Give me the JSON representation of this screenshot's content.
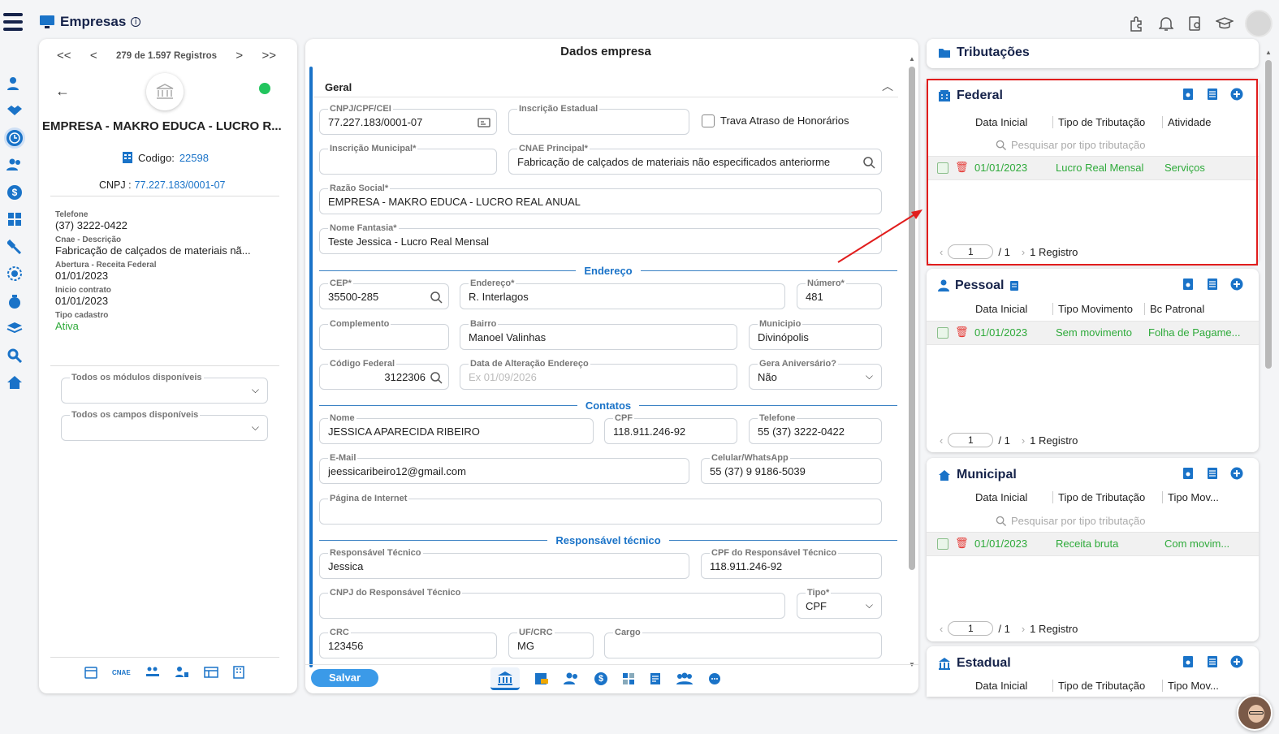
{
  "app": {
    "title": "Empresas"
  },
  "nav": {
    "first": "<<",
    "prev": "<",
    "record_count": "279 de 1.597 Registros",
    "next": ">",
    "last": ">>"
  },
  "company": {
    "name": "EMPRESA - MAKRO EDUCA - LUCRO R...",
    "code_label": "Codigo:",
    "code": "22598",
    "cnpj_label": "CNPJ :",
    "cnpj": "77.227.183/0001-07",
    "status_color": "#22c55e"
  },
  "info": [
    {
      "label": "Telefone",
      "value": "(37) 3222-0422"
    },
    {
      "label": "Cnae - Descrição",
      "value": "Fabricação de calçados de materiais nã..."
    },
    {
      "label": "Abertura - Receita Federal",
      "value": "01/01/2023"
    },
    {
      "label": "Inicio contrato",
      "value": "01/01/2023"
    },
    {
      "label": "Tipo cadastro",
      "value": "Ativa"
    }
  ],
  "filters": {
    "modules": "Todos os módulos disponíveis",
    "fields": "Todos os campos disponíveis"
  },
  "left_bottom": {
    "cnae": "CNAE"
  },
  "form": {
    "header": "Dados empresa",
    "section_general": "Geral",
    "cnpj": {
      "label": "CNPJ/CPF/CEI",
      "value": "77.227.183/0001-07"
    },
    "ie": {
      "label": "Inscrição Estadual",
      "value": ""
    },
    "trava": "Trava Atraso de Honorários",
    "im": {
      "label": "Inscrição Municipal*",
      "value": ""
    },
    "cnae": {
      "label": "CNAE Principal*",
      "value": "Fabricação de calçados de materiais não especificados anteriorme"
    },
    "razao": {
      "label": "Razão Social*",
      "value": "EMPRESA - MAKRO EDUCA - LUCRO REAL ANUAL"
    },
    "fantasia": {
      "label": "Nome Fantasia*",
      "value": "Teste Jessica - Lucro Real Mensal"
    },
    "sec_endereco": "Endereço",
    "cep": {
      "label": "CEP*",
      "value": "35500-285"
    },
    "endereco": {
      "label": "Endereço*",
      "value": "R. Interlagos"
    },
    "numero": {
      "label": "Número*",
      "value": "481"
    },
    "complemento": {
      "label": "Complemento",
      "value": ""
    },
    "bairro": {
      "label": "Bairro",
      "value": "Manoel Valinhas"
    },
    "municipio": {
      "label": "Municipio",
      "value": "Divinópolis"
    },
    "codfed": {
      "label": "Código Federal",
      "value": "3122306"
    },
    "dataalt": {
      "label": "Data de Alteração Endereço",
      "placeholder": "Ex 01/09/2026"
    },
    "aniv": {
      "label": "Gera Aniversário?",
      "value": "Não"
    },
    "sec_contatos": "Contatos",
    "nome": {
      "label": "Nome",
      "value": "JESSICA APARECIDA RIBEIRO"
    },
    "cpf": {
      "label": "CPF",
      "value": "118.911.246-92"
    },
    "telefone": {
      "label": "Telefone",
      "value": "55 (37) 3222-0422"
    },
    "email": {
      "label": "E-Mail",
      "value": "jeessicaribeiro12@gmail.com"
    },
    "celular": {
      "label": "Celular/WhatsApp",
      "value": "55 (37) 9 9186-5039"
    },
    "pagina": {
      "label": "Página de Internet",
      "value": ""
    },
    "sec_resp": "Responsável técnico",
    "resp": {
      "label": "Responsável Técnico",
      "value": "Jessica"
    },
    "cpfresp": {
      "label": "CPF do Responsável Técnico",
      "value": "118.911.246-92"
    },
    "cnpjresp": {
      "label": "CNPJ do Responsável Técnico",
      "value": ""
    },
    "tipo": {
      "label": "Tipo*",
      "value": "CPF"
    },
    "crc": {
      "label": "CRC",
      "value": "123456"
    },
    "ufcrc": {
      "label": "UF/CRC",
      "value": "MG"
    },
    "cargo": {
      "label": "Cargo",
      "value": ""
    },
    "save": "Salvar"
  },
  "tributacoes": {
    "title": "Tributações",
    "federal": {
      "title": "Federal",
      "cols": [
        "Data Inicial",
        "Tipo de Tributação",
        "Atividade"
      ],
      "search": "Pesquisar por tipo tributação",
      "row": [
        "01/01/2023",
        "Lucro Real Mensal",
        "Serviços"
      ],
      "page": "1",
      "pages": "/ 1",
      "count": "1 Registro"
    },
    "pessoal": {
      "title": "Pessoal",
      "cols": [
        "Data Inicial",
        "Tipo Movimento",
        "Bc Patronal"
      ],
      "row": [
        "01/01/2023",
        "Sem movimento",
        "Folha de Pagame..."
      ],
      "page": "1",
      "pages": "/ 1",
      "count": "1 Registro"
    },
    "municipal": {
      "title": "Municipal",
      "cols": [
        "Data Inicial",
        "Tipo de Tributação",
        "Tipo Mov..."
      ],
      "search": "Pesquisar por tipo tributação",
      "row": [
        "01/01/2023",
        "Receita bruta",
        "Com movim..."
      ],
      "page": "1",
      "pages": "/ 1",
      "count": "1 Registro"
    },
    "estadual": {
      "title": "Estadual",
      "cols": [
        "Data Inicial",
        "Tipo de Tributação",
        "Tipo Mov..."
      ]
    }
  },
  "colors": {
    "accent": "#1a73c8",
    "navy": "#16234a",
    "green": "#2eaa3a",
    "highlight": "#e11d1d"
  }
}
